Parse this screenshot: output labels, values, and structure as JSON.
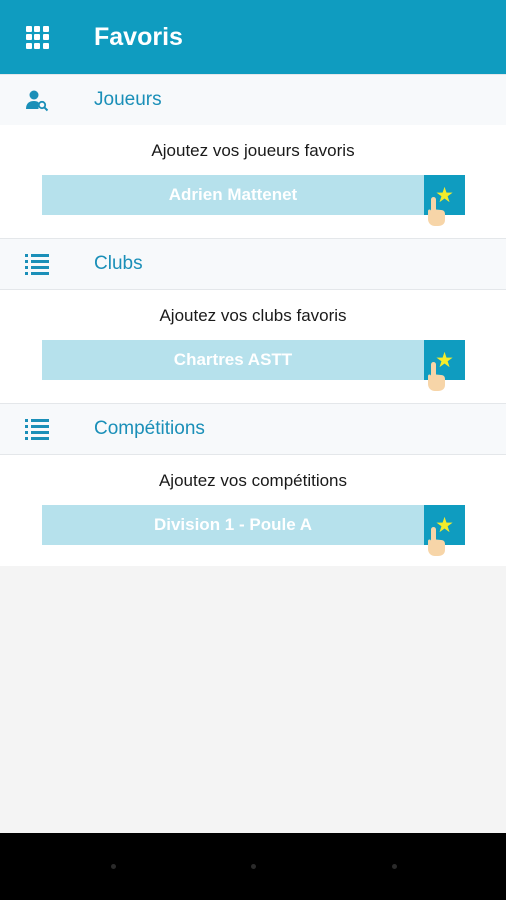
{
  "app_bar": {
    "title": "Favoris",
    "menu_icon": "apps-grid-icon",
    "background": "#0f9cc0"
  },
  "sections": [
    {
      "header": "Joueurs",
      "icon": "player-search-icon",
      "subtitle": "Ajoutez vos joueurs favoris",
      "example": "Adrien Mattenet",
      "star_icon": "star-icon"
    },
    {
      "header": "Clubs",
      "icon": "list-icon",
      "subtitle": "Ajoutez vos clubs favoris",
      "example": "Chartres ASTT",
      "star_icon": "star-icon"
    },
    {
      "header": "Compétitions",
      "icon": "list-icon",
      "subtitle": "Ajoutez vos compétitions",
      "example": "Division 1 - Poule A",
      "star_icon": "star-icon"
    }
  ],
  "colors": {
    "accent": "#0f9cc0",
    "header_text": "#1a8fb8",
    "bar_fill": "#b6e1ec",
    "star": "#f4ec2a"
  }
}
